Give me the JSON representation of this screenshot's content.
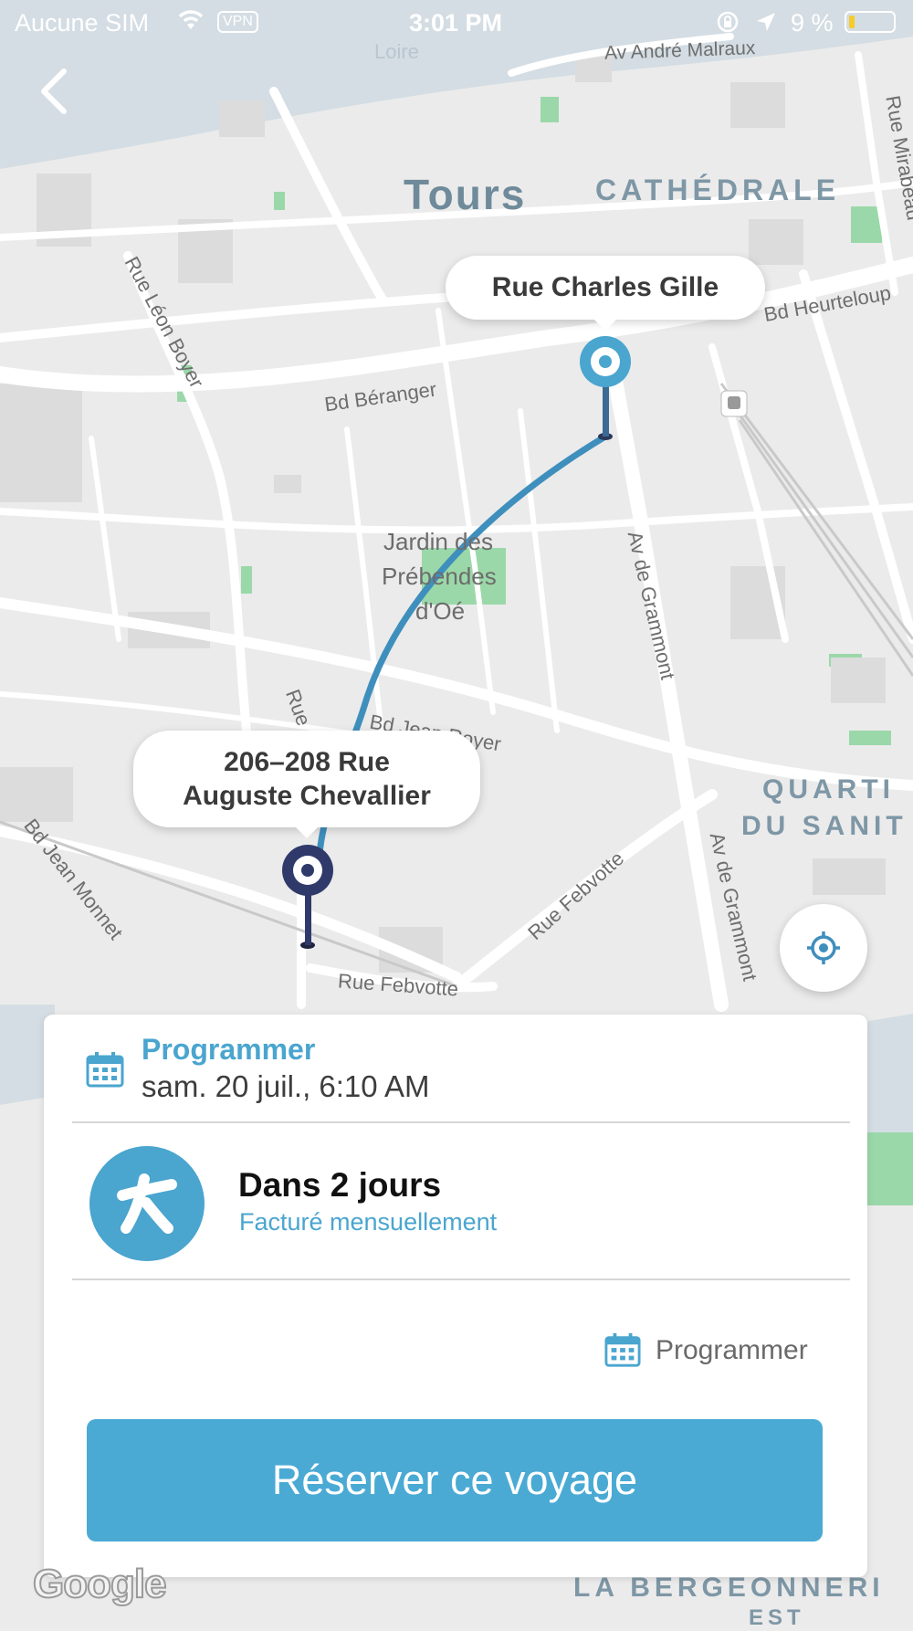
{
  "status_bar": {
    "carrier": "Aucune SIM",
    "vpn": "VPN",
    "time": "3:01 PM",
    "battery": "9 %"
  },
  "map": {
    "labels": {
      "city": "Tours",
      "district_cathedrale": "CATHÉDRALE",
      "district_quartier_1": "QUARTI",
      "district_quartier_2": "DU SANIT",
      "district_bergeonnerie_1": "LA BERGEONNERI",
      "district_bergeonnerie_2": "EST",
      "park_1": "Jardin des",
      "park_2": "Prébendes",
      "park_3": "d'Oé",
      "street_malraux": "Av André Malraux",
      "street_beranger": "Bd Béranger",
      "street_heurteloup": "Bd Heurteloup",
      "street_leon_boyer": "Rue Léon Boyer",
      "street_grammont_1": "Av de Grammont",
      "street_grammont_2": "Av de Grammont",
      "street_febvotte_1": "Rue Febvotte",
      "street_febvotte_2": "Rue Febvotte",
      "street_jean_royer": "Bd Jean Royer",
      "street_jean_monnet": "Bd Jean Monnet",
      "street_mirabeau": "Rue Mirabeau",
      "street_loire": "Loire",
      "street_rue": "Rue"
    },
    "destination_callout": "Rue Charles Gille",
    "origin_callout_line1": "206–208 Rue",
    "origin_callout_line2": "Auguste Chevallier",
    "google": "Google"
  },
  "booking_card": {
    "schedule_title": "Programmer",
    "schedule_date": "sam. 20 juil., 6:10 AM",
    "service_title": "Dans 2 jours",
    "service_subtitle": "Facturé mensuellement",
    "schedule_link": "Programmer",
    "book_button": "Réserver ce voyage"
  },
  "colors": {
    "accent": "#4aa5cf",
    "origin_pin": "#2f3a6b",
    "route": "#3f8fbd"
  },
  "icons": [
    "back-icon",
    "wifi-icon",
    "location-arrow-icon",
    "lock-rotation-icon",
    "calendar-icon",
    "locate-icon",
    "service-logo-icon",
    "train-station-icon"
  ]
}
